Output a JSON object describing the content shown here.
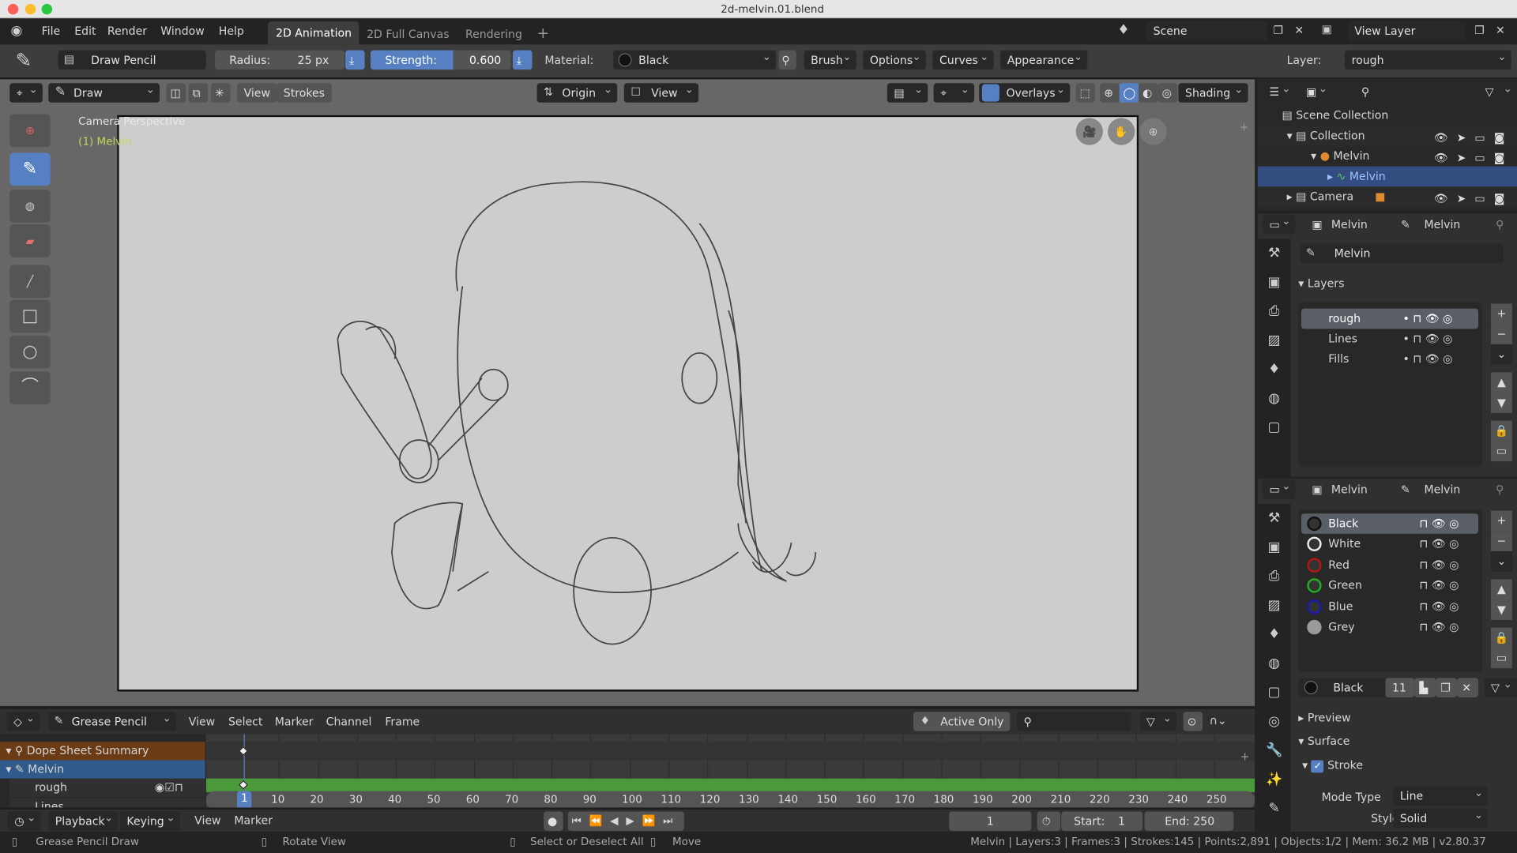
{
  "window": {
    "title": "2d-melvin.01.blend"
  },
  "menu": {
    "items": [
      "File",
      "Edit",
      "Render",
      "Window",
      "Help"
    ],
    "workspaces": [
      "2D Animation",
      "2D Full Canvas",
      "Rendering"
    ],
    "active_workspace": "2D Animation",
    "add_tab": "+",
    "scene": "Scene",
    "view_layer": "View Layer"
  },
  "toolsettings": {
    "brush": "Draw Pencil",
    "radius_label": "Radius:",
    "radius_value": "25 px",
    "strength_label": "Strength:",
    "strength_value": "0.600",
    "material_label": "Material:",
    "material": "Black",
    "menus": [
      "Brush",
      "Options",
      "Curves",
      "Appearance"
    ],
    "layer_label": "Layer:",
    "layer": "rough"
  },
  "viewport": {
    "mode": "Draw",
    "view_btn": "View",
    "strokes_btn": "Strokes",
    "origin": "Origin",
    "view2": "View",
    "overlays": "Overlays",
    "shading": "Shading",
    "camera_label": "Camera Perspective",
    "object_label": "(1) Melvin",
    "stroke_color": "#444444",
    "canvas_color": "#cdcdcd"
  },
  "toolbar": {
    "tools": [
      "cursor-icon",
      "draw-icon",
      "fill-icon",
      "erase-icon",
      "line-icon",
      "box-icon",
      "circle-icon",
      "arc-icon"
    ]
  },
  "outliner": {
    "items": [
      {
        "label": "Scene Collection"
      },
      {
        "label": "Collection"
      },
      {
        "label": "Melvin"
      },
      {
        "label": "Melvin",
        "selected": true
      },
      {
        "label": "Camera"
      }
    ]
  },
  "properties": {
    "header_object": "Melvin",
    "header_data": "Melvin",
    "data_name": "Melvin",
    "layers_title": "Layers",
    "layers": [
      {
        "name": "rough",
        "active": true
      },
      {
        "name": "Lines"
      },
      {
        "name": "Fills"
      }
    ],
    "materials": [
      {
        "name": "Black",
        "color": "#111111",
        "active": true
      },
      {
        "name": "White",
        "color": "#eeeeee"
      },
      {
        "name": "Red",
        "color": "#b01818"
      },
      {
        "name": "Green",
        "color": "#20b020"
      },
      {
        "name": "Blue",
        "color": "#1a1ab0"
      },
      {
        "name": "Grey",
        "color": "#9a9a9a"
      }
    ],
    "material_slot": "Black",
    "material_users": "11",
    "preview": "Preview",
    "surface": "Surface",
    "stroke": "Stroke",
    "stroke_enabled": true,
    "mode_type_label": "Mode Type",
    "mode_type": "Line",
    "style_label": "Style",
    "style": "Solid"
  },
  "dopesheet": {
    "mode": "Grease Pencil",
    "menus": [
      "View",
      "Select",
      "Marker",
      "Channel",
      "Frame"
    ],
    "active_only": "Active Only",
    "channels": [
      {
        "name": "Dope Sheet Summary"
      },
      {
        "name": "Melvin"
      },
      {
        "name": "rough"
      },
      {
        "name": "Lines"
      }
    ],
    "frame_ticks": [
      10,
      20,
      30,
      40,
      50,
      60,
      70,
      80,
      90,
      100,
      110,
      120,
      130,
      140,
      150,
      160,
      170,
      180,
      190,
      200,
      210,
      220,
      230,
      240,
      250
    ],
    "current_frame": "1",
    "keyframes": [
      1
    ]
  },
  "timeline": {
    "playback": "Playback",
    "keying": "Keying",
    "view": "View",
    "marker": "Marker",
    "frame": "1",
    "start_label": "Start:",
    "start": "1",
    "end_label": "End:",
    "end": "250"
  },
  "status": {
    "left": "Grease Pencil Draw",
    "middle": "Rotate View",
    "select": "Select or Deselect All",
    "move": "Move",
    "stats": "Melvin | Layers:3 | Frames:3 | Strokes:145 | Points:2,891 | Objects:1/2 | Mem: 36.2 MB | v2.80.37"
  }
}
